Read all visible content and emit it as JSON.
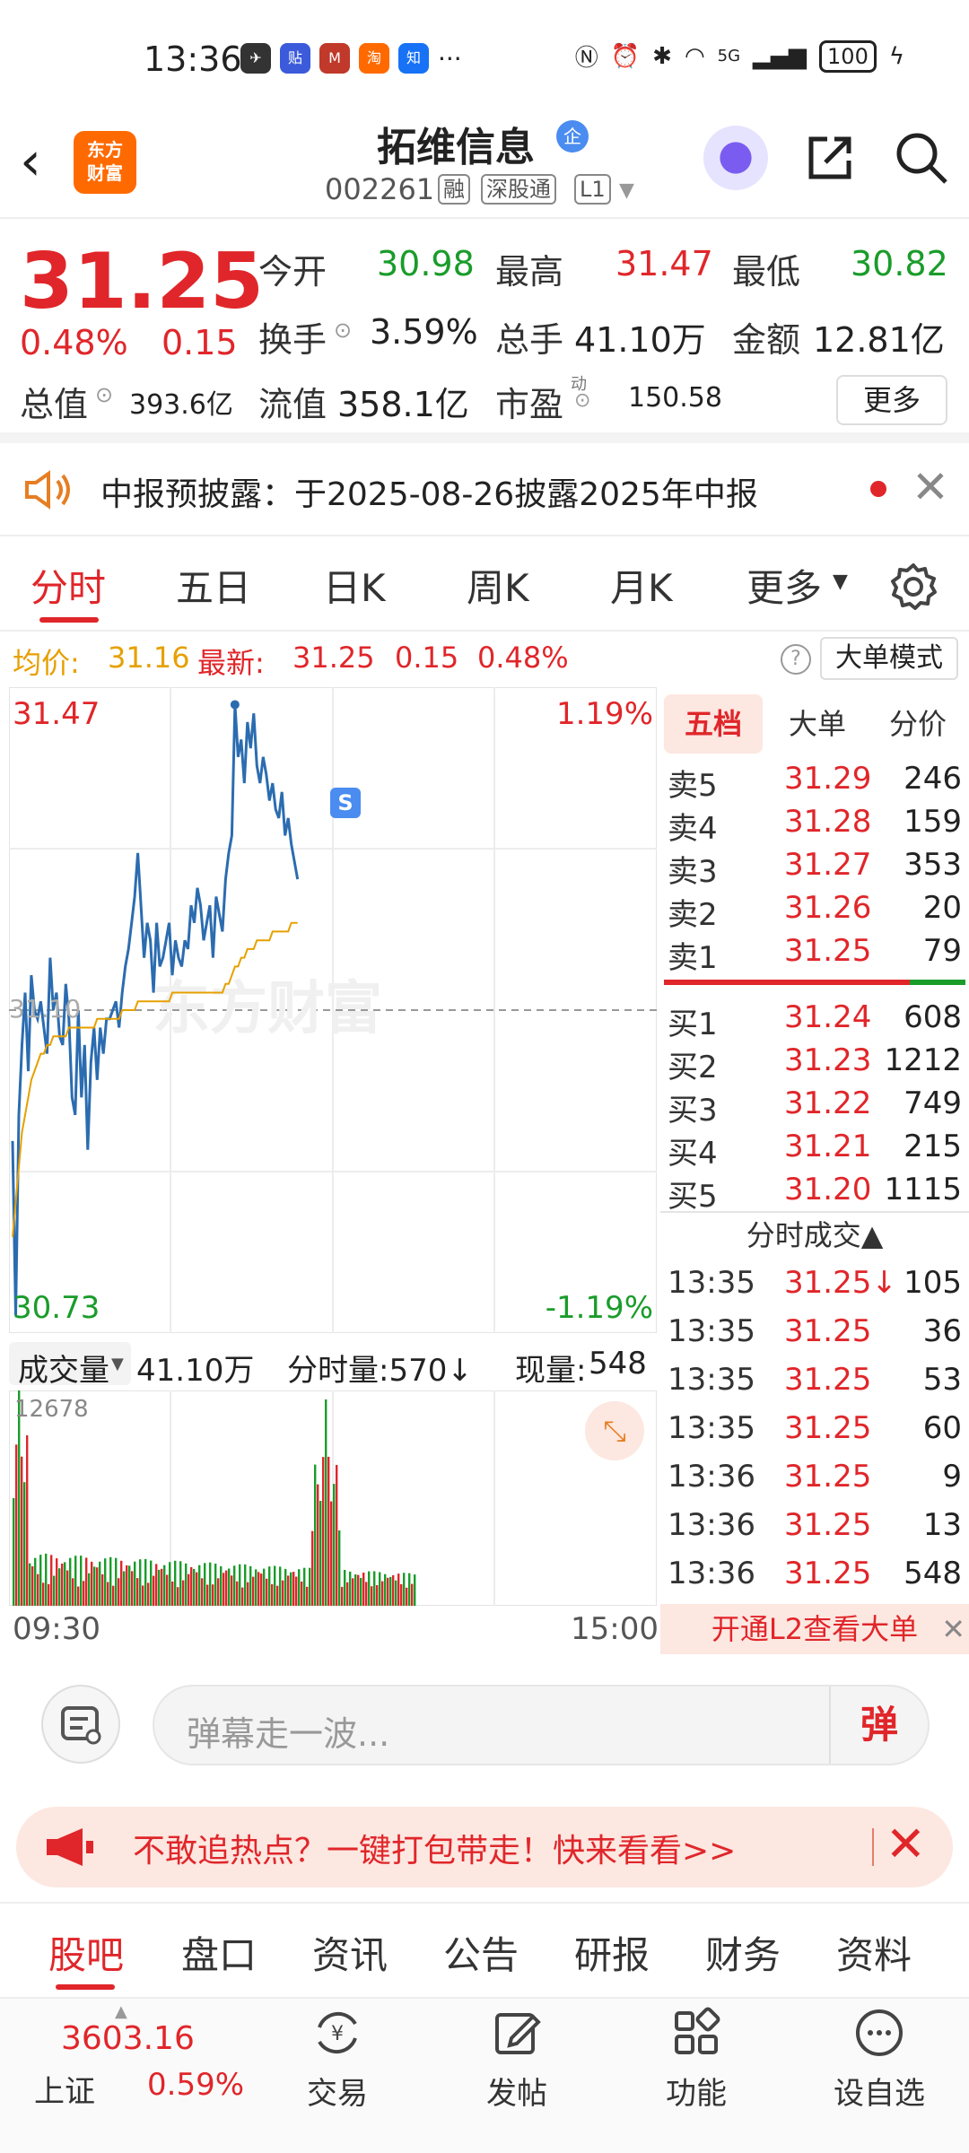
{
  "status_bar": {
    "time": "13:36",
    "more": "···",
    "battery": "100",
    "network": "5G"
  },
  "header": {
    "logo_line1": "东方",
    "logo_line2": "财富",
    "stock_name": "拓维信息",
    "badge": "企",
    "stock_code": "002261",
    "tags": [
      "融",
      "深股通",
      "L1"
    ]
  },
  "quote": {
    "price": "31.25",
    "change_pct": "0.48%",
    "change": "0.15",
    "open_label": "今开",
    "open": "30.98",
    "high_label": "最高",
    "high": "31.47",
    "low_label": "最低",
    "low": "30.82",
    "turnover_label": "换手",
    "turnover": "3.59%",
    "volume_label": "总手",
    "volume": "41.10万",
    "amount_label": "金额",
    "amount": "12.81亿",
    "mktcap_label": "总值",
    "mktcap": "393.6亿",
    "float_label": "流值",
    "float": "358.1亿",
    "pe_label": "市盈",
    "pe_sup": "动",
    "pe": "150.58",
    "more_label": "更多"
  },
  "notice": {
    "text": "中报预披露：于2025-08-26披露2025年中报"
  },
  "chart_tabs": [
    "分时",
    "五日",
    "日K",
    "周K",
    "月K",
    "更多"
  ],
  "info_line": {
    "avg_label": "均价:",
    "avg": "31.16",
    "latest_label": "最新:",
    "latest": "31.25",
    "chg": "0.15",
    "pct": "0.48%",
    "help": "?",
    "big_order_mode": "大单模式"
  },
  "chart_data": {
    "type": "line",
    "y_max_label": "31.47",
    "y_min_label": "30.73",
    "y_max_pct": "1.19%",
    "y_min_pct": "-1.19%",
    "prev_close_label": "31.10",
    "x_start": "09:30",
    "x_end": "15:00",
    "ylim": [
      30.73,
      31.47
    ],
    "prev_close": 31.1,
    "s_marker": "S",
    "series": [
      {
        "values": [
          30.95,
          30.75,
          30.98,
          31.06,
          31.12,
          31.03,
          31.14,
          31.1,
          31.09,
          31.11,
          31.08,
          31.05,
          31.16,
          31.1,
          31.12,
          31.07,
          31.06,
          31.13,
          31.09,
          31.0,
          30.98,
          31.1,
          31.0,
          31.06,
          30.94,
          31.04,
          31.08,
          31.02,
          31.08,
          31.05,
          31.09,
          31.09,
          31.1,
          31.11,
          31.08,
          31.12,
          31.15,
          31.17,
          31.2,
          31.23,
          31.28,
          31.22,
          31.16,
          31.2,
          31.18,
          31.12,
          31.2,
          31.15,
          31.16,
          31.18,
          31.2,
          31.14,
          31.18,
          31.16,
          31.15,
          31.18,
          31.17,
          31.22,
          31.2,
          31.24,
          31.22,
          31.18,
          31.2,
          31.22,
          31.16,
          31.23,
          31.21,
          31.19,
          31.25,
          31.28,
          31.3,
          31.45,
          31.39,
          31.41,
          31.36,
          31.43,
          31.4,
          31.44,
          31.38,
          31.36,
          31.39,
          31.37,
          31.34,
          31.36,
          31.33,
          31.32,
          31.35,
          31.3,
          31.32,
          31.29,
          31.27,
          31.25
        ]
      },
      {
        "values": [
          30.84,
          30.88,
          30.92,
          30.96,
          30.98,
          31.0,
          31.02,
          31.03,
          31.04,
          31.05,
          31.05,
          31.06,
          31.06,
          31.07,
          31.07,
          31.07,
          31.07,
          31.07,
          31.08,
          31.08,
          31.08,
          31.08,
          31.08,
          31.08,
          31.08,
          31.08,
          31.08,
          31.09,
          31.09,
          31.09,
          31.09,
          31.09,
          31.09,
          31.09,
          31.09,
          31.1,
          31.1,
          31.1,
          31.1,
          31.1,
          31.11,
          31.11,
          31.11,
          31.11,
          31.11,
          31.11,
          31.11,
          31.11,
          31.11,
          31.11,
          31.11,
          31.12,
          31.12,
          31.12,
          31.12,
          31.12,
          31.12,
          31.12,
          31.12,
          31.12,
          31.12,
          31.12,
          31.12,
          31.12,
          31.12,
          31.12,
          31.12,
          31.12,
          31.13,
          31.13,
          31.14,
          31.15,
          31.15,
          31.16,
          31.16,
          31.17,
          31.17,
          31.17,
          31.18,
          31.18,
          31.18,
          31.18,
          31.18,
          31.19,
          31.19,
          31.19,
          31.19,
          31.19,
          31.19,
          31.2,
          31.2,
          31.2
        ]
      }
    ]
  },
  "order_book": {
    "tabs": [
      "五档",
      "大单",
      "分价"
    ],
    "asks": [
      {
        "label": "卖5",
        "price": "31.29",
        "vol": "246"
      },
      {
        "label": "卖4",
        "price": "31.28",
        "vol": "159"
      },
      {
        "label": "卖3",
        "price": "31.27",
        "vol": "353"
      },
      {
        "label": "卖2",
        "price": "31.26",
        "vol": "20"
      },
      {
        "label": "卖1",
        "price": "31.25",
        "vol": "79"
      }
    ],
    "bids": [
      {
        "label": "买1",
        "price": "31.24",
        "vol": "608"
      },
      {
        "label": "买2",
        "price": "31.23",
        "vol": "1212"
      },
      {
        "label": "买3",
        "price": "31.22",
        "vol": "749"
      },
      {
        "label": "买4",
        "price": "31.21",
        "vol": "215"
      },
      {
        "label": "买5",
        "price": "31.20",
        "vol": "1115"
      }
    ],
    "tick_title": "分时成交▲",
    "ticks": [
      {
        "time": "13:35",
        "price": "31.25↓",
        "vol": "105"
      },
      {
        "time": "13:35",
        "price": "31.25",
        "vol": "36"
      },
      {
        "time": "13:35",
        "price": "31.25",
        "vol": "53"
      },
      {
        "time": "13:35",
        "price": "31.25",
        "vol": "60"
      },
      {
        "time": "13:36",
        "price": "31.25",
        "vol": "9"
      },
      {
        "time": "13:36",
        "price": "31.25",
        "vol": "13"
      },
      {
        "time": "13:36",
        "price": "31.25",
        "vol": "548"
      }
    ],
    "l2_promo": "开通L2查看大单"
  },
  "volume": {
    "label": "成交量",
    "total": "41.10万",
    "minute_label": "分时量:570↓",
    "now_label": "现量:",
    "now": "548",
    "max_label": "12678"
  },
  "comment": {
    "placeholder": "弹幕走一波...",
    "dan": "弹"
  },
  "promo": {
    "text": "不敢追热点？一键打包带走！快来看看>>"
  },
  "bottom_tabs": [
    "股吧",
    "盘口",
    "资讯",
    "公告",
    "研报",
    "财务",
    "资料"
  ],
  "bottom_nav": {
    "index_value": "3603.16",
    "index_name": "上证",
    "index_pct": "0.59%",
    "items": [
      "交易",
      "发帖",
      "功能",
      "设自选"
    ]
  }
}
